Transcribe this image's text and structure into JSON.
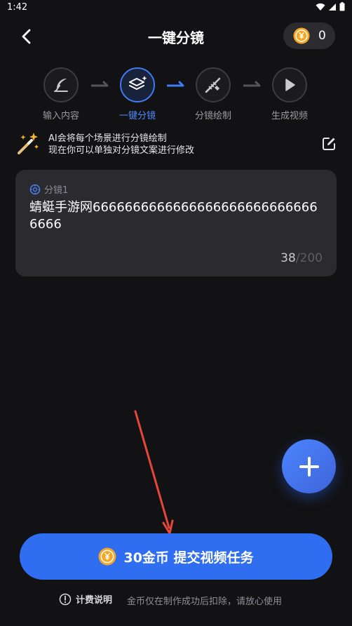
{
  "status_bar": {
    "time": "1:42"
  },
  "header": {
    "title": "一键分镜",
    "coin_count": "0"
  },
  "steps": [
    {
      "label": "输入内容",
      "icon": "feather-pen-icon",
      "active": false
    },
    {
      "label": "一键分镜",
      "icon": "layers-sparkle-icon",
      "active": true
    },
    {
      "label": "分镜绘制",
      "icon": "brush-ruler-icon",
      "active": false
    },
    {
      "label": "生成视频",
      "icon": "play-icon",
      "active": false
    }
  ],
  "hint": {
    "line1": "AI会将每个场景进行分镜绘制",
    "line2": "现在你可以单独对分镜文案进行修改"
  },
  "storyboard": {
    "label": "分镜1",
    "text": "蜻蜓手游网66666666666666666666666666666666",
    "count_current": "38",
    "count_max": "/200"
  },
  "submit": {
    "label": "30金币 提交视频任务"
  },
  "footer": {
    "billing_label": "计费说明",
    "note": "金币仅在制作成功后扣除，请放心使用"
  },
  "colors": {
    "accent": "#2f6ef0",
    "active_step": "#4c8bff",
    "background": "#121214",
    "card": "#2a2a2f",
    "coin": "#f5a623",
    "annotation_arrow": "#e8453c"
  }
}
